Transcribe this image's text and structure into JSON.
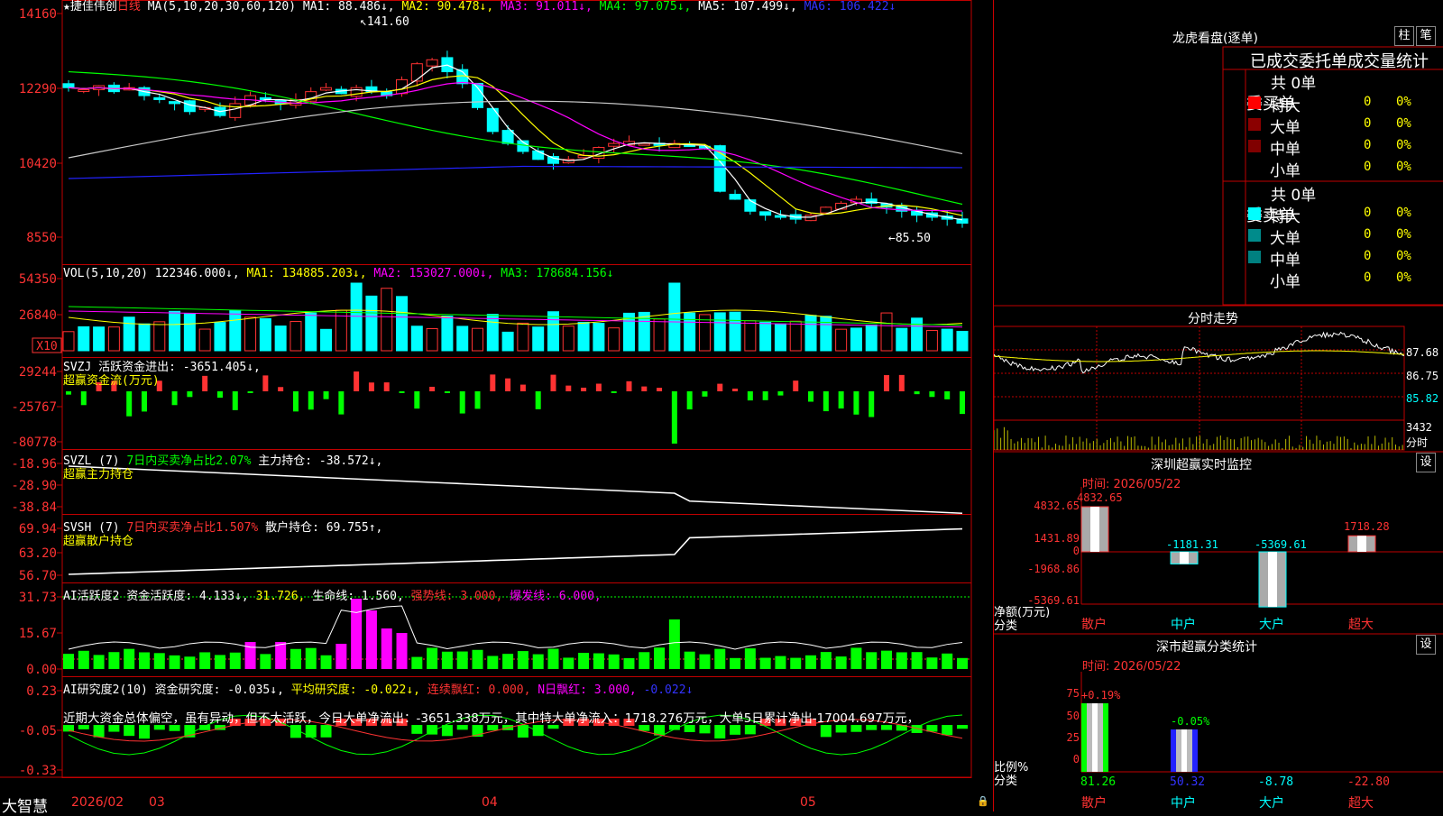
{
  "stock": {
    "name": "捷佳伟创",
    "period": "日线"
  },
  "colors": {
    "up": "#ff3333",
    "down": "#00ffff",
    "ma1": "#ffffff",
    "ma2": "#ffff00",
    "ma3": "#ff00ff",
    "ma4": "#00ff00",
    "ma5": "#c8c8c8",
    "ma6": "#2222ff",
    "grid": "#c00000"
  },
  "kline": {
    "header": {
      "ma_label": "MA(5,10,20,30,60,120)",
      "ma1": "MA1: 88.486↓,",
      "ma2": "MA2: 90.478↓,",
      "ma3": "MA3: 91.011↓,",
      "ma4": "MA4: 97.075↓,",
      "ma5": "MA5: 107.499↓,",
      "ma6": "MA6: 106.422↓"
    },
    "y_labels": [
      "14160",
      "12290",
      "10420",
      "8550"
    ],
    "high_label": "141.60",
    "low_label": "←85.50"
  },
  "vol": {
    "header": {
      "label": "VOL(5,10,20)",
      "v": "122346.000↓,",
      "ma1": "MA1: 134885.203↓,",
      "ma2": "MA2: 153027.000↓,",
      "ma3": "MA3: 178684.156↓"
    },
    "y_labels": [
      "54350",
      "26840"
    ],
    "unit": "X10"
  },
  "svzj": {
    "header": {
      "label": "SVZJ",
      "v": "活跃资金进出: -3651.405↓,"
    },
    "sub": "超赢资金流(万元)",
    "y_labels": [
      "29244",
      "-25767",
      "-80778"
    ]
  },
  "svzl": {
    "header": {
      "label": "SVZL (7)",
      "v1": "7日内买卖净占比2.07%",
      "v2": "主力持仓: -38.572↓,"
    },
    "sub": "超赢主力持仓",
    "y_labels": [
      "-18.96",
      "-28.90",
      "-38.84"
    ]
  },
  "svsh": {
    "header": {
      "label": "SVSH (7)",
      "v1": "7日内买卖净占比1.507%",
      "v2": "散户持仓: 69.755↑,"
    },
    "sub": "超赢散户持仓",
    "y_labels": [
      "69.94",
      "63.20",
      "56.70"
    ]
  },
  "ai1": {
    "header": {
      "label": "AI活跃度2",
      "v1": "资金活跃度: 4.133↓,",
      "v2": "31.726,",
      "v3": "生命线: 1.560,",
      "v4": "强势线: 3.000,",
      "v5": "爆发线: 6.000,"
    },
    "y_labels": [
      "31.73",
      "15.67",
      "0.00"
    ]
  },
  "ai2": {
    "header": {
      "label": "AI研究度2(10)",
      "v1": "资金研究度: -0.035↓,",
      "v2": "平均研究度: -0.022↓,",
      "v3": "连续飘红: 0.000,",
      "v4": "N日飘红: 3.000,",
      "v5": "-0.022↓"
    },
    "note": "近期大资金总体偏空，虽有异动，但不太活跃，今日大单净流出：-3651.338万元，其中特大单净流入：1718.276万元，大单5日累计净出-17004.697万元，",
    "y_labels": [
      "0.23",
      "-0.05",
      "-0.33"
    ]
  },
  "bottom": {
    "logo": "大智慧",
    "dates": [
      "2026/02",
      "03",
      "04",
      "05"
    ]
  },
  "lhb": {
    "title": "龙虎看盘(逐单)",
    "btn1": "柱",
    "btn2": "笔",
    "col_header": "已成交委托单成交量统计",
    "buy": {
      "side": "委买单",
      "total": "共 0单",
      "rows": [
        {
          "label": "特大",
          "val": "0",
          "pct": "0%"
        },
        {
          "label": "大单",
          "val": "0",
          "pct": "0%"
        },
        {
          "label": "中单",
          "val": "0",
          "pct": "0%"
        },
        {
          "label": "小单",
          "val": "0",
          "pct": "0%"
        }
      ]
    },
    "sell": {
      "side": "委卖单",
      "total": "共 0单",
      "rows": [
        {
          "label": "特大",
          "val": "0",
          "pct": "0%"
        },
        {
          "label": "大单",
          "val": "0",
          "pct": "0%"
        },
        {
          "label": "中单",
          "val": "0",
          "pct": "0%"
        },
        {
          "label": "小单",
          "val": "0",
          "pct": "0%"
        }
      ]
    }
  },
  "intraday": {
    "title": "分时走势",
    "price_labels": [
      "87.68",
      "86.75",
      "85.82"
    ],
    "vol_label": "3432",
    "unit": "分时"
  },
  "sz_monitor": {
    "title": "深圳超赢实时监控",
    "btn": "设",
    "time": "时间: 2026/05/22",
    "y_labels": [
      "4832.65",
      "1431.89",
      "0",
      "-1968.86",
      "-5369.61"
    ],
    "axis_label1": "净额(万元)",
    "axis_label2": "分类",
    "categories": [
      "散户",
      "中户",
      "大户",
      "超大"
    ],
    "values": [
      4832.65,
      -1181.31,
      -5369.61,
      1718.28
    ],
    "value_labels": [
      "4832.65",
      "-1181.31",
      "-5369.61",
      "1718.28"
    ]
  },
  "sz_class": {
    "title": "深市超赢分类统计",
    "btn": "设",
    "time": "时间: 2026/05/22",
    "y_labels": [
      "75",
      "50",
      "25",
      "0"
    ],
    "axis_label1": "比例%",
    "axis_label2": "分类",
    "categories": [
      "散户",
      "中户",
      "大户",
      "超大"
    ],
    "top_labels": [
      "+0.19%",
      "-0.05%"
    ],
    "bottom_values": [
      "81.26",
      "50.32",
      "-8.78",
      "-22.80"
    ]
  }
}
